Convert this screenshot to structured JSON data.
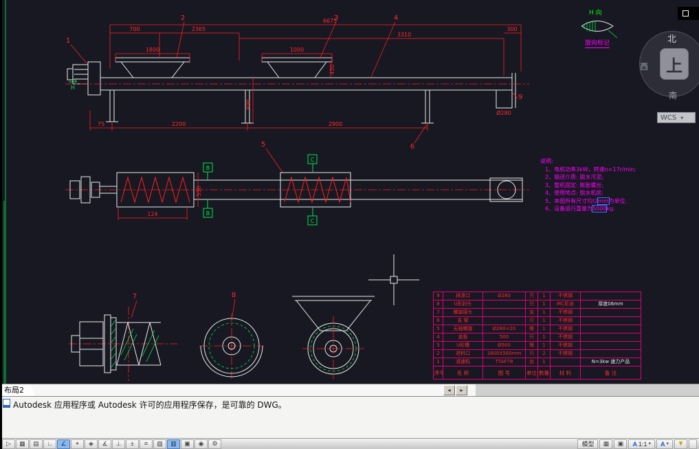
{
  "window": {
    "layout_tab": "布局2",
    "command_text": "Autodesk 应用程序或 Autodesk 许可的应用程序保存，是可靠的 DWG。"
  },
  "viewcube": {
    "north": "北",
    "west": "西",
    "up": "上",
    "south": "南",
    "wcs": "WCS",
    "dropdown": "▾"
  },
  "h_marker": {
    "title": "H 向",
    "caption": "旋向标记"
  },
  "sections": {
    "a": "A",
    "b": "B",
    "c": "C",
    "h": "H"
  },
  "callouts": {
    "c1": "1",
    "c2": "2",
    "c3": "3",
    "c4": "4",
    "c5": "5",
    "c6": "6",
    "c7": "7",
    "c8": "8",
    "c9": "9"
  },
  "dims": {
    "d700": "700",
    "d2365": "2365",
    "d6675": "6675",
    "d3310": "3310",
    "d300": "300",
    "d1800": "1800",
    "d1000": "1000",
    "d450": "450",
    "d930": "930",
    "d75": "75",
    "d2200": "2200",
    "d2900": "2900",
    "dia280": "Ø280",
    "d124": "124",
    "d550": "550"
  },
  "notes": {
    "title": "说明:",
    "l1": "1、电机功率3kW，转速n=17r/min;",
    "l2": "2、输送介质: 脱水污泥;",
    "l3": "3、整机固定: 膨胀螺丝;",
    "l4": "4、使用地点: 脱水机房;",
    "l5_pre": "5、本图所有尺寸均以",
    "l5_hl": "mm",
    "l5_post": "为单位.",
    "l6_pre": "6、设备运行重量为",
    "l6_hl": "5000",
    "l6_post": "kg."
  },
  "parts_table": {
    "headers": [
      "序号",
      "名  称",
      "图  号",
      "单位",
      "数量",
      "材  料",
      "备  注"
    ],
    "rows": [
      {
        "cells": [
          "9",
          "排渣口",
          "Ø280",
          "只",
          "1",
          "不锈钢",
          ""
        ],
        "white": []
      },
      {
        "cells": [
          "8",
          "U形封头",
          "",
          "只",
          "1",
          "MC尼龙",
          "厚度δ6mm"
        ],
        "white": [
          6
        ]
      },
      {
        "cells": [
          "7",
          "螺旋接头",
          "",
          "支",
          "1",
          "不锈钢",
          ""
        ],
        "white": []
      },
      {
        "cells": [
          "6",
          "支  架",
          "",
          "只",
          "1",
          "不锈钢",
          ""
        ],
        "white": []
      },
      {
        "cells": [
          "5",
          "无轴螺旋",
          "Ø280×20",
          "根",
          "1",
          "不锈钢",
          ""
        ],
        "white": []
      },
      {
        "cells": [
          "4",
          "盖板",
          "500",
          "只",
          "1",
          "不锈钢",
          ""
        ],
        "white": []
      },
      {
        "cells": [
          "3",
          "U形槽",
          "Ø500",
          "根",
          "1",
          "不锈钢",
          ""
        ],
        "white": []
      },
      {
        "cells": [
          "2",
          "进料口",
          "1600X560mm",
          "只",
          "2",
          "不锈钢",
          ""
        ],
        "white": []
      },
      {
        "cells": [
          "1",
          "减速机",
          "TTAF78",
          "台",
          "1",
          "",
          "N=3kw 速力产品"
        ],
        "white": [
          6
        ]
      }
    ]
  },
  "scrollbar": {
    "left_arrow": "◂",
    "right_arrow": "▸"
  },
  "statusbar": {
    "left_icons": [
      {
        "name": "infer-constraints-icon",
        "glyph": "▷",
        "active": false
      },
      {
        "name": "snap-mode-icon",
        "glyph": "▦",
        "active": false
      },
      {
        "name": "grid-display-icon",
        "glyph": "▤",
        "active": false
      },
      {
        "name": "ortho-mode-icon",
        "glyph": "∟",
        "active": false
      },
      {
        "name": "polar-tracking-icon",
        "glyph": "∠",
        "active": true
      },
      {
        "name": "object-snap-icon",
        "glyph": "⌖",
        "active": false
      },
      {
        "name": "3d-object-snap-icon",
        "glyph": "◈",
        "active": false
      },
      {
        "name": "object-snap-tracking-icon",
        "glyph": "∡",
        "active": false
      },
      {
        "name": "dynamic-ucs-icon",
        "glyph": "⊥",
        "active": false
      },
      {
        "name": "dynamic-input-icon",
        "glyph": "±",
        "active": false
      },
      {
        "name": "lineweight-icon",
        "glyph": "≡",
        "active": false
      },
      {
        "name": "transparency-icon",
        "glyph": "▨",
        "active": false
      },
      {
        "name": "quick-properties-icon",
        "glyph": "▥",
        "active": true
      },
      {
        "name": "selection-cycling-icon",
        "glyph": "▣",
        "active": false
      },
      {
        "name": "annotation-monitor-icon",
        "glyph": "◉",
        "active": false
      },
      {
        "name": "workspace-gear-icon",
        "glyph": "⚙",
        "active": false
      }
    ],
    "model_label": "模型",
    "layout_btn1": "▦",
    "layout_btn2": "▣",
    "scale_letter": "A",
    "scale_value": "1:1",
    "annotation_letter": "A",
    "dropdown": "▾",
    "funnel": "▼"
  }
}
